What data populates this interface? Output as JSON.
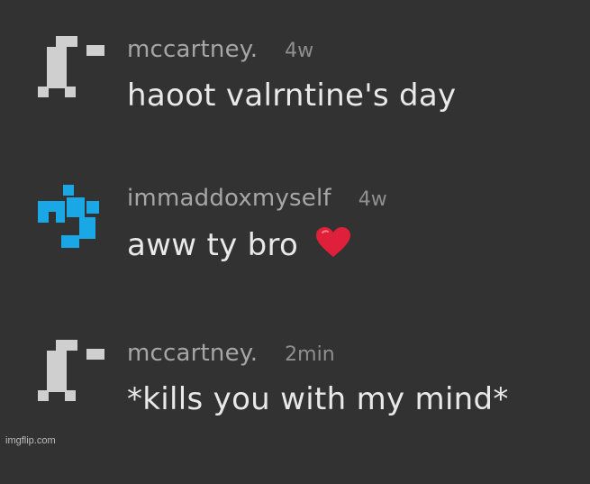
{
  "comments": [
    {
      "username": "mccartney.",
      "time": "4w",
      "text": "haoot valrntine's day",
      "avatar_color": "#cfcfcf"
    },
    {
      "username": "immaddoxmyself",
      "time": "4w",
      "text": "aww ty bro",
      "emoji": "heart-icon",
      "avatar_color": "#1aa7e6"
    },
    {
      "username": "mccartney.",
      "time": "2min",
      "text": "*kills you with my mind*",
      "avatar_color": "#cfcfcf"
    }
  ],
  "watermark": "imgflip.com",
  "colors": {
    "background": "#323232",
    "username": "#a6a6a6",
    "timestamp": "#8f8f8f",
    "body_text": "#e9e9e9",
    "heart": "#e0203a"
  }
}
